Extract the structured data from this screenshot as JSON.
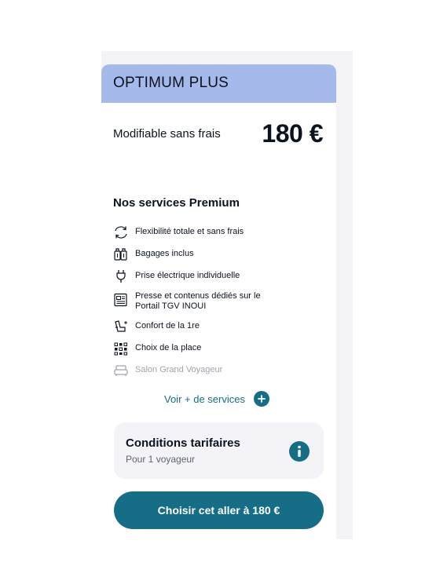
{
  "offer": {
    "title": "OPTIMUM PLUS",
    "price_label": "Modifiable sans frais",
    "price": "180 €"
  },
  "services": {
    "title": "Nos services Premium",
    "items": [
      {
        "label": "Flexibilité totale et sans frais",
        "icon": "exchange-arrows-icon",
        "enabled": true
      },
      {
        "label": "Bagages inclus",
        "icon": "luggage-icon",
        "enabled": true
      },
      {
        "label": "Prise électrique individuelle",
        "icon": "power-plug-icon",
        "enabled": true
      },
      {
        "label": "Presse et contenus dédiés sur le Portail TGV INOUI",
        "icon": "newspaper-icon",
        "enabled": true
      },
      {
        "label": "Confort de la 1re",
        "icon": "comfort-seat-icon",
        "enabled": true
      },
      {
        "label": "Choix de la place",
        "icon": "seat-map-icon",
        "enabled": true
      },
      {
        "label": "Salon Grand Voyageur",
        "icon": "lounge-sofa-icon",
        "enabled": false
      }
    ],
    "more_label": "Voir + de services"
  },
  "conditions": {
    "title": "Conditions tarifaires",
    "subtitle": "Pour 1 voyageur"
  },
  "cta": {
    "label": "Choisir cet aller à 180 €"
  },
  "colors": {
    "header_bg": "#a5baea",
    "accent": "#156e85",
    "panel_bg": "#f3f3f8",
    "text": "#0c131f",
    "disabled_text": "#a1a4ab"
  }
}
